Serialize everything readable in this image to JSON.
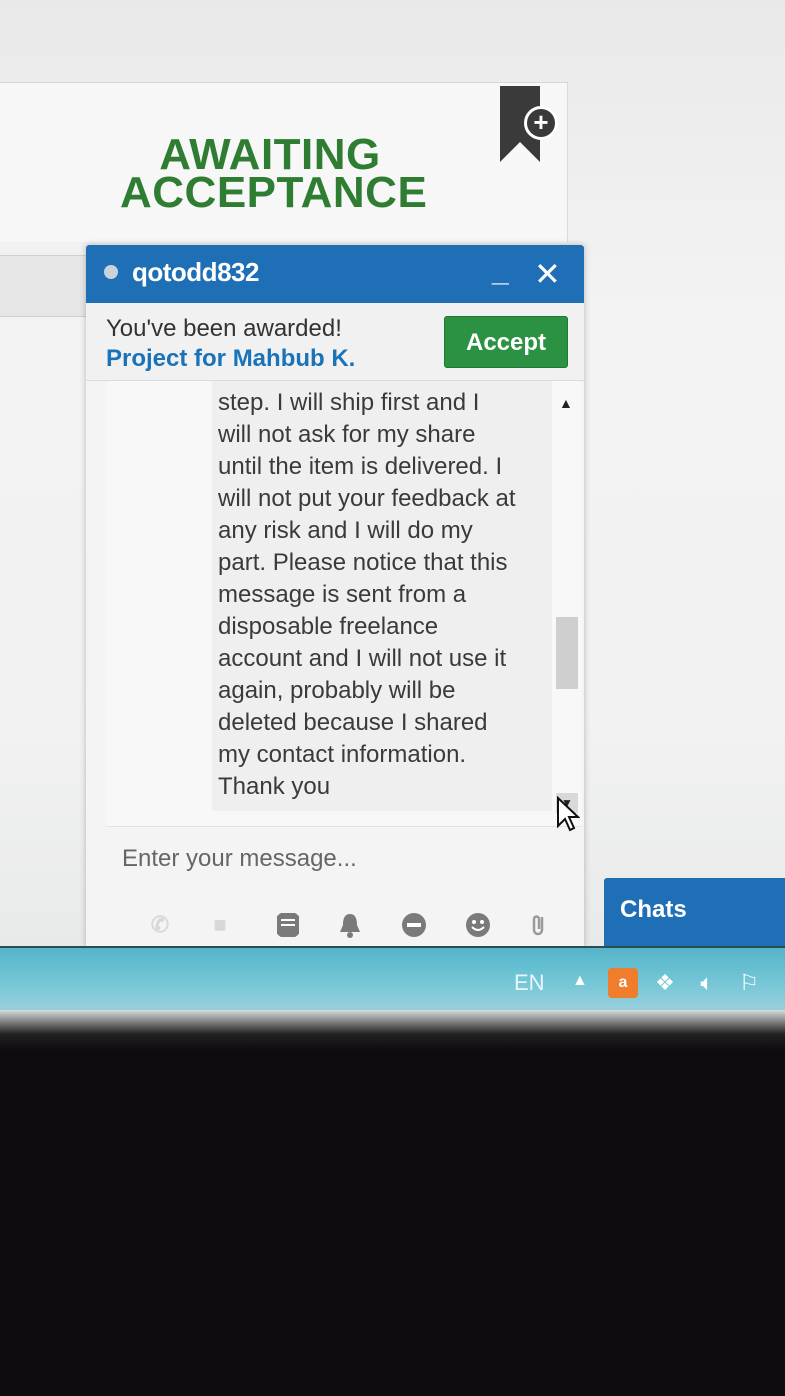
{
  "card": {
    "status_title": "AWAITING ACCEPTANCE",
    "bookmark_icon": "bookmark-add-icon"
  },
  "chat": {
    "username": "qotodd832",
    "presence": "offline",
    "award_text": "You've been awarded!",
    "project_link": "Project for Mahbub K.",
    "accept_label": "Accept",
    "message": "step. I will ship first and I\nwill not ask for my share\nuntil the item is delivered. I\nwill not put your feedback at\nany risk and I will do my\npart. Please notice that this\nmessage is sent from a\ndisposable freelance\naccount and I will not use it\nagain, probably will be\ndeleted because I shared\nmy contact information.\nThank you",
    "input_placeholder": "Enter your message...",
    "toolbar_icons": [
      "phone-icon",
      "video-icon",
      "file-icon",
      "bell-icon",
      "block-icon",
      "emoji-icon",
      "attachment-icon"
    ]
  },
  "chats_tab": {
    "label": "Chats"
  },
  "taskbar": {
    "language": "EN",
    "tray_icons": [
      "show-hidden-icons-chevron",
      "avast-icon",
      "dropbox-icon",
      "volume-icon",
      "action-center-flag-icon"
    ]
  },
  "colors": {
    "brand_blue": "#1f6fb6",
    "accept_green": "#2a9242",
    "status_green": "#2e7d32"
  }
}
